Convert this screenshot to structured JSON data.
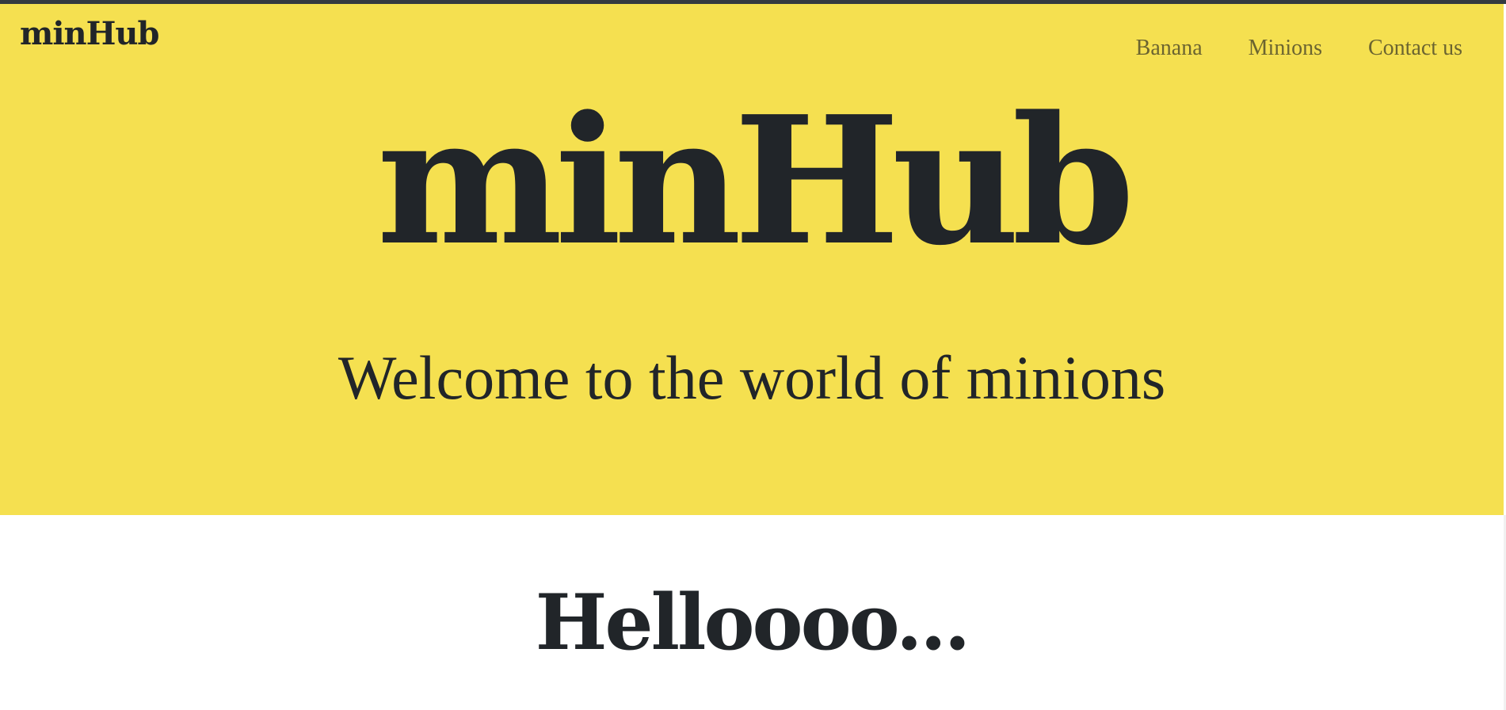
{
  "navbar": {
    "brand": "minHub",
    "links": [
      "Banana",
      "Minions",
      "Contact us"
    ]
  },
  "hero": {
    "title": "minHub",
    "subtitle": "Welcome to the world of minions"
  },
  "section": {
    "heading": "Helloooo..."
  },
  "colors": {
    "hero_background": "#f5e050",
    "text": "#212529",
    "nav_link": "#6b6430",
    "top_border": "#343a40"
  }
}
